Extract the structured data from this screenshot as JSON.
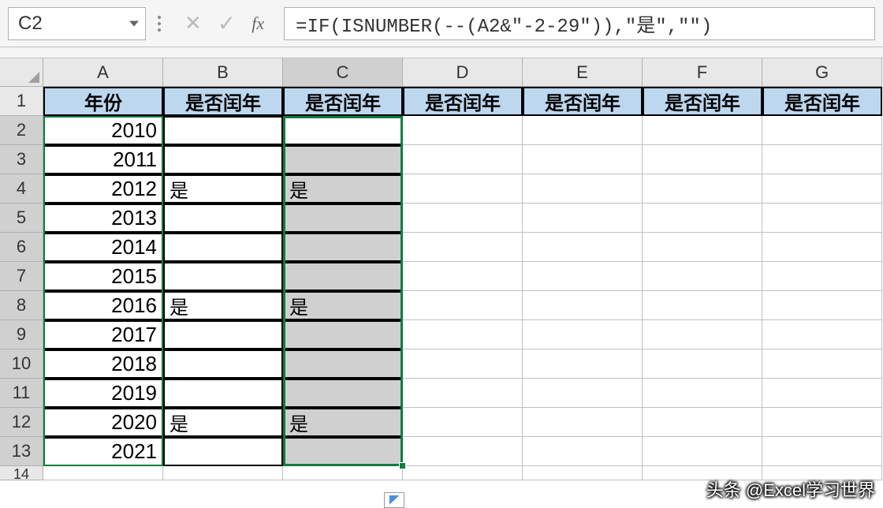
{
  "nameBox": "C2",
  "formula": "=IF(ISNUMBER(--(A2&\"-2-29\")),\"是\",\"\")",
  "fxLabel": "fx",
  "columns": [
    "A",
    "B",
    "C",
    "D",
    "E",
    "F",
    "G"
  ],
  "activeColumn": "C",
  "rows": [
    "1",
    "2",
    "3",
    "4",
    "5",
    "6",
    "7",
    "8",
    "9",
    "10",
    "11",
    "12",
    "13",
    "14"
  ],
  "activeRowsStart": 2,
  "activeRowsEnd": 13,
  "headers": {
    "A": "年份",
    "B": "是否闰年",
    "C": "是否闰年",
    "D": "是否闰年",
    "E": "是否闰年",
    "F": "是否闰年",
    "G": "是否闰年"
  },
  "data": [
    {
      "year": "2010",
      "b": "",
      "c": ""
    },
    {
      "year": "2011",
      "b": "",
      "c": ""
    },
    {
      "year": "2012",
      "b": "是",
      "c": "是"
    },
    {
      "year": "2013",
      "b": "",
      "c": ""
    },
    {
      "year": "2014",
      "b": "",
      "c": ""
    },
    {
      "year": "2015",
      "b": "",
      "c": ""
    },
    {
      "year": "2016",
      "b": "是",
      "c": "是"
    },
    {
      "year": "2017",
      "b": "",
      "c": ""
    },
    {
      "year": "2018",
      "b": "",
      "c": ""
    },
    {
      "year": "2019",
      "b": "",
      "c": ""
    },
    {
      "year": "2020",
      "b": "是",
      "c": "是"
    },
    {
      "year": "2021",
      "b": "",
      "c": ""
    }
  ],
  "watermark": "头条 @Excel学习世界"
}
